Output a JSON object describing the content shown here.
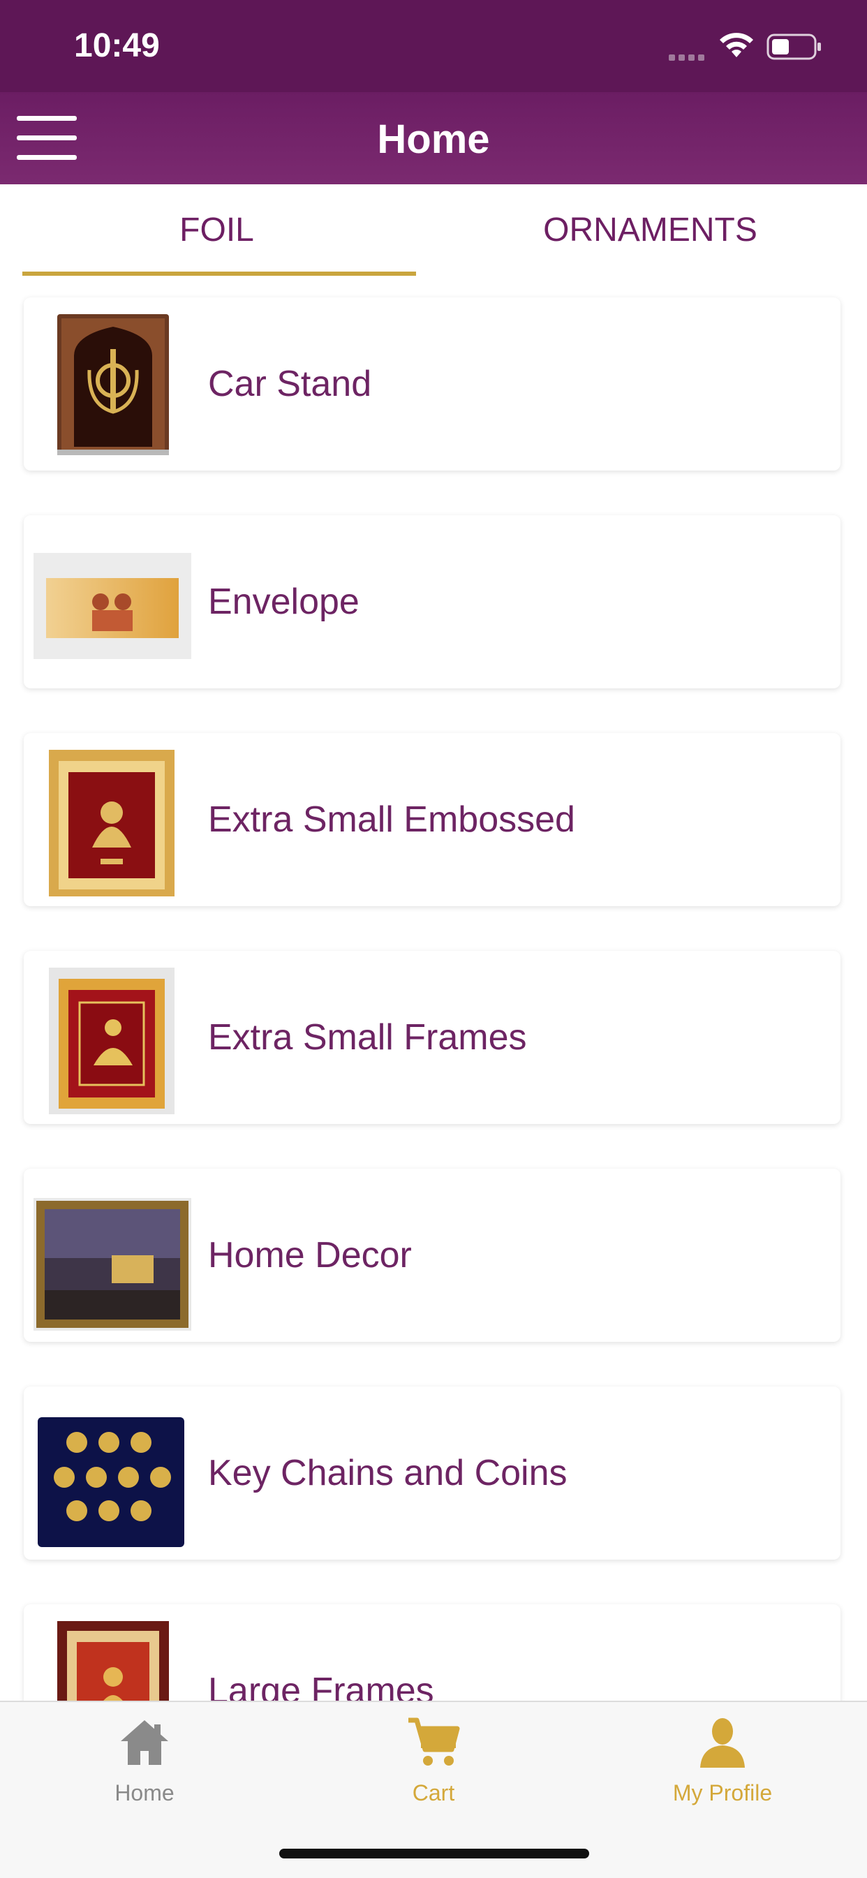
{
  "status_bar": {
    "time": "10:49"
  },
  "nav": {
    "title": "Home"
  },
  "tabs": [
    {
      "label": "FOIL",
      "selected": true
    },
    {
      "label": "ORNAMENTS",
      "selected": false
    }
  ],
  "categories": [
    {
      "label": "Car Stand",
      "thumb": "khanda-car-stand"
    },
    {
      "label": "Envelope",
      "thumb": "shiva-parvati-envelope"
    },
    {
      "label": "Extra Small Embossed",
      "thumb": "lakshmi-embossed-frame"
    },
    {
      "label": "Extra Small Frames",
      "thumb": "red-gold-small-frame"
    },
    {
      "label": "Home Decor",
      "thumb": "colosseum-decor-frame"
    },
    {
      "label": "Key Chains and Coins",
      "thumb": "gold-coins-box"
    },
    {
      "label": "Large Frames",
      "thumb": "large-gold-frame"
    }
  ],
  "bottom_nav": [
    {
      "label": "Home",
      "icon": "house-icon",
      "color": "#8a8a8a"
    },
    {
      "label": "Cart",
      "icon": "cart-icon",
      "color": "#d4a83a"
    },
    {
      "label": "My Profile",
      "icon": "person-icon",
      "color": "#d4a83a"
    }
  ],
  "colors": {
    "primary": "#5e1756",
    "accent": "#c9a53e",
    "label": "#6d2463"
  }
}
